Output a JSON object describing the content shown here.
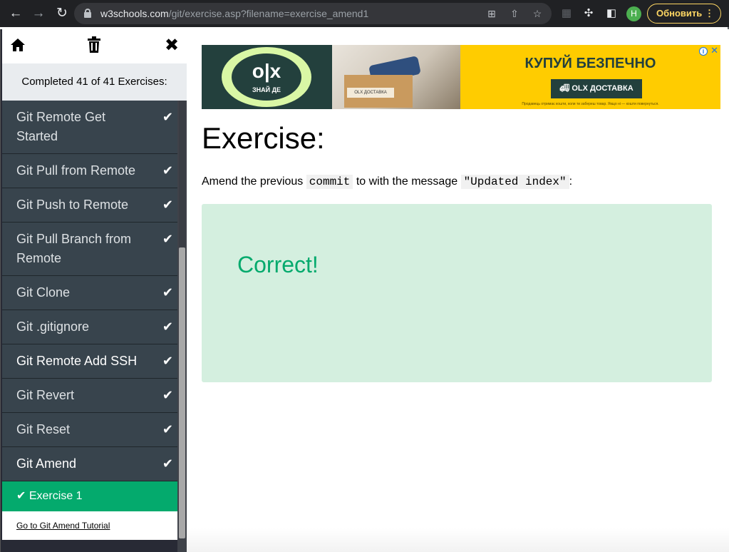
{
  "browser": {
    "url_host": "w3schools.com",
    "url_path": "/git/exercise.asp?filename=exercise_amend1",
    "profile_initial": "Н",
    "update_label": "Обновить",
    "icons": {
      "back": "back-arrow-icon",
      "forward": "forward-arrow-icon",
      "reload": "reload-icon",
      "lock": "lock-icon",
      "translate": "translate-icon",
      "share": "share-icon",
      "bookmark": "star-icon",
      "extension": "puzzle-icon",
      "side_panel": "side-panel-icon",
      "menu": "three-dots-icon"
    }
  },
  "sidebar": {
    "icons": [
      "home-icon",
      "trash-icon",
      "close-icon"
    ],
    "completed_text": "Completed 41 of 41 Exercises:",
    "items": [
      {
        "label": "Git Remote Get Started",
        "done": true
      },
      {
        "label": "Git Pull from Remote",
        "done": true
      },
      {
        "label": "Git Push to Remote",
        "done": true
      },
      {
        "label": "Git Pull Branch from Remote",
        "done": true
      },
      {
        "label": "Git Clone",
        "done": true
      },
      {
        "label": "Git .gitignore",
        "done": true
      },
      {
        "label": "Git Remote Add SSH",
        "done": true
      },
      {
        "label": "Git Revert",
        "done": true
      },
      {
        "label": "Git Reset",
        "done": true
      },
      {
        "label": "Git Amend",
        "done": true
      }
    ],
    "active_exercise": "Exercise 1",
    "tutorial_link": "Go to Git Amend Tutorial"
  },
  "ad": {
    "logo": "o|x",
    "tagline": "ЗНАЙ ДЕ",
    "box_label": "OLX ДОСТАВКА",
    "headline": "КУПУЙ БЕЗПЕЧНО",
    "cta": "OLX ДОСТАВКА",
    "fine_print": "Продавець отримає кошти, коли ти забереш товар. Якщо ні — кошти повернуться.",
    "info": "i",
    "close": "✕"
  },
  "main": {
    "title": "Exercise:",
    "instruction": {
      "part1": "Amend the previous",
      "code1": "commit",
      "part2": "to with the message",
      "code2": "\"Updated index\"",
      "part3": ":"
    },
    "result": "Correct!"
  },
  "colors": {
    "accent": "#04aa6d",
    "sidebar_item": "#38444d",
    "result_bg": "#d4efdf",
    "chrome_bg": "#202124",
    "update_yellow": "#fdd663"
  }
}
